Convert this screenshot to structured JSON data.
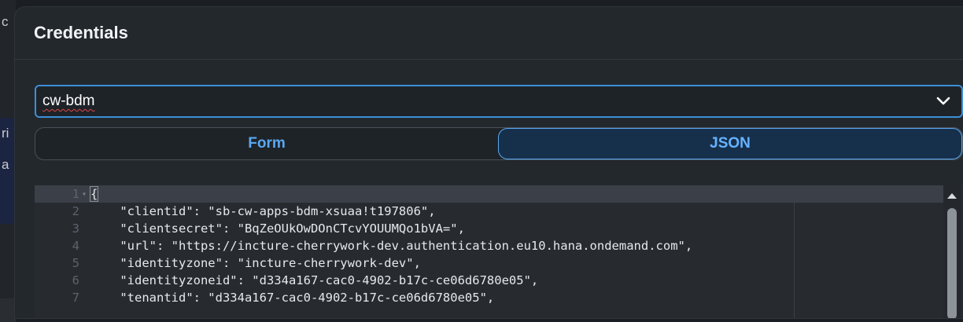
{
  "dialog": {
    "title": "Credentials"
  },
  "instance_select": {
    "value": "cw-bdm",
    "icon": "chevron-down-icon"
  },
  "view_toggle": {
    "options": [
      "Form",
      "JSON"
    ],
    "selected": "JSON"
  },
  "background": {
    "glyphs": [
      "c",
      "ri",
      "a"
    ]
  },
  "editor": {
    "lines": [
      {
        "number": "1",
        "text": "{"
      },
      {
        "number": "2",
        "text": "    \"clientid\": \"sb-cw-apps-bdm-xsuaa!t197806\","
      },
      {
        "number": "3",
        "text": "    \"clientsecret\": \"BqZeOUkOwDOnCTcvYOUUMQo1bVA=\","
      },
      {
        "number": "4",
        "text": "    \"url\": \"https://incture-cherrywork-dev.authentication.eu10.hana.ondemand.com\","
      },
      {
        "number": "5",
        "text": "    \"identityzone\": \"incture-cherrywork-dev\","
      },
      {
        "number": "6",
        "text": "    \"identityzoneid\": \"d334a167-cac0-4902-b17c-ce06d6780e05\","
      },
      {
        "number": "7",
        "text": "    \"tenantid\": \"d334a167-cac0-4902-b17c-ce06d6780e05\","
      }
    ]
  },
  "colors": {
    "accent": "#3d8fd9",
    "toggle_active_bg": "#16304c",
    "dialog_bg": "#23282d"
  }
}
